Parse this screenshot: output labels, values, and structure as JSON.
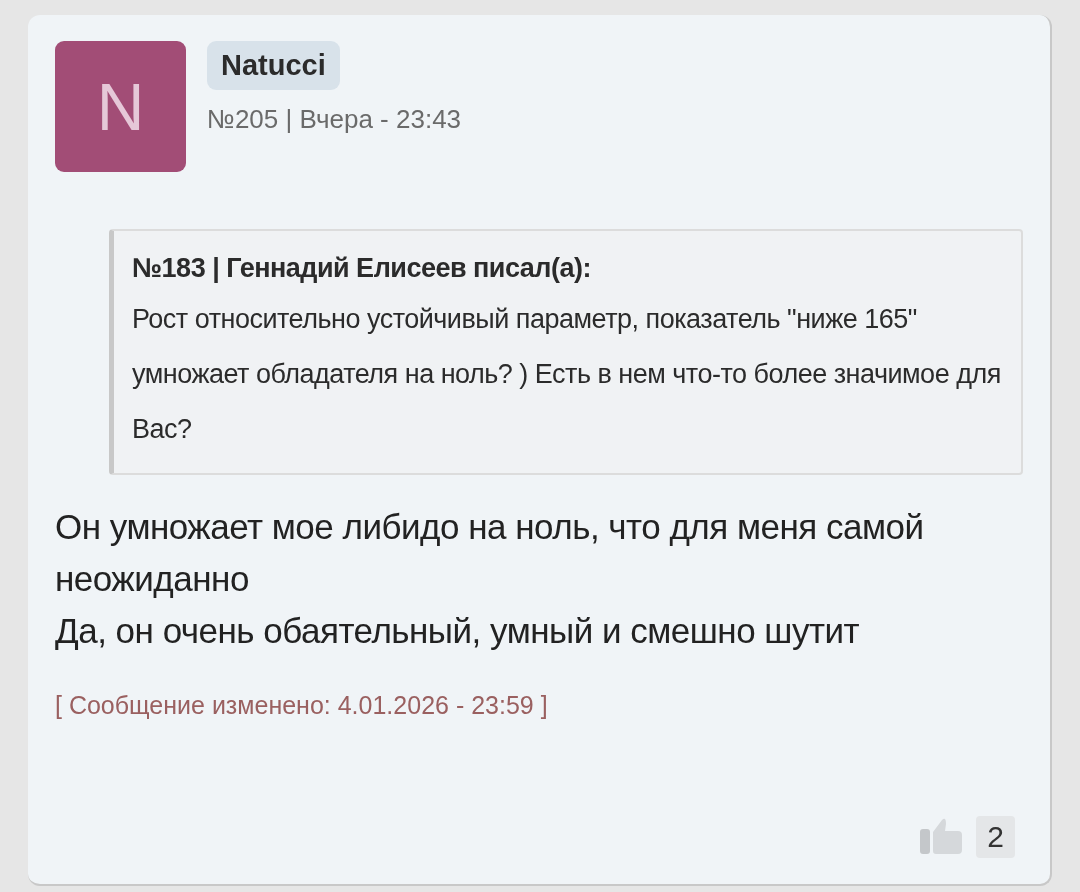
{
  "post": {
    "avatar": {
      "letter": "N",
      "color": "#a24d76"
    },
    "author": "Natucci",
    "meta": "№205 | Вчера - 23:43",
    "quote": {
      "header": "№183 | Геннадий Елисеев писал(а):",
      "text": "Рост относительно устойчивый параметр, показатель \"ниже 165\" умножает обладателя на ноль? ) Есть в нем что-то более значимое для Вас?"
    },
    "body": [
      "Он умножает мое либидо на ноль, что для меня самой неожиданно",
      "Да, он очень обаятельный, умный и смешно шутит"
    ],
    "edited": "[ Сообщение изменено: 4.01.2026 - 23:59 ]",
    "likes": "2"
  }
}
